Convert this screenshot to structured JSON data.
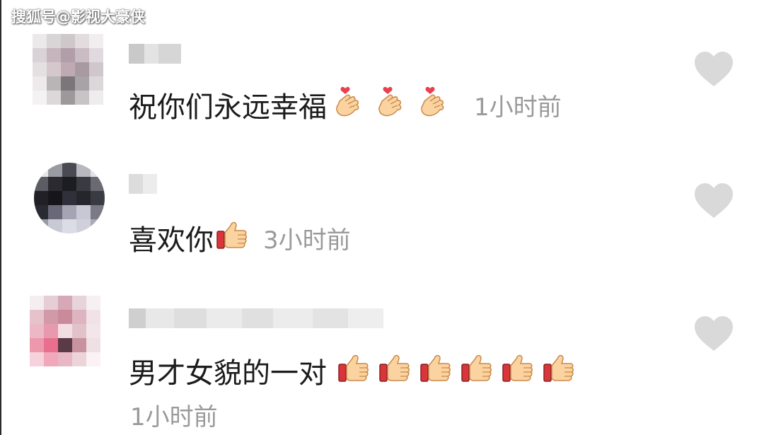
{
  "watermark": "搜狐号@影视大豪侠",
  "colors": {
    "like_heart": "#d9d9d9",
    "timestamp": "#9a9a9a",
    "text": "#1b1b1b"
  },
  "comments": [
    {
      "text": "祝你们永远幸福",
      "emoji_icons": [
        "finger-heart-emoji",
        "finger-heart-emoji",
        "finger-heart-emoji"
      ],
      "time": "1小时前",
      "liked": false
    },
    {
      "text": "喜欢你",
      "emoji_icons": [
        "thumbs-up-emoji"
      ],
      "time": "3小时前",
      "liked": false
    },
    {
      "text": "男才女貌的一对",
      "emoji_icons": [
        "thumbs-up-emoji",
        "thumbs-up-emoji",
        "thumbs-up-emoji",
        "thumbs-up-emoji",
        "thumbs-up-emoji",
        "thumbs-up-emoji"
      ],
      "time": "1小时前",
      "liked": false
    }
  ]
}
